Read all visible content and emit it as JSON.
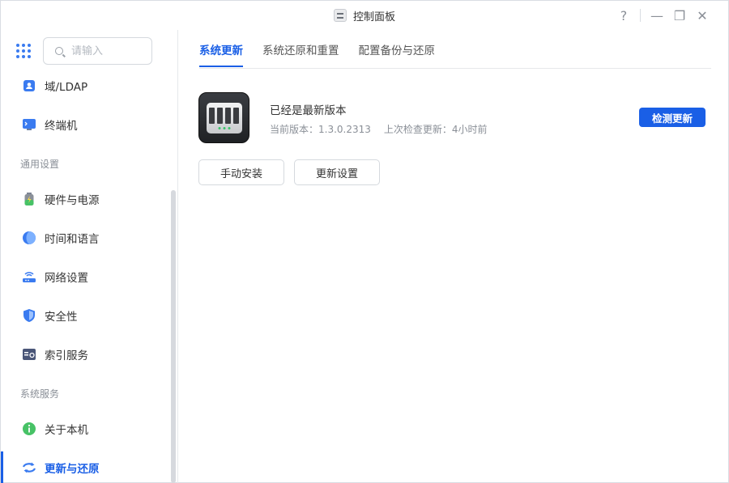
{
  "window": {
    "title": "控制面板",
    "controls": {
      "help": "?",
      "minimize": "—",
      "restore": "❐",
      "close": "✕"
    }
  },
  "sidebar": {
    "search_placeholder": "请输入",
    "items": [
      {
        "label": "域/LDAP",
        "icon": "ldap-icon"
      },
      {
        "label": "终端机",
        "icon": "terminal-icon"
      },
      {
        "section": "通用设置"
      },
      {
        "label": "硬件与电源",
        "icon": "battery-icon"
      },
      {
        "label": "时间和语言",
        "icon": "globe-icon"
      },
      {
        "label": "网络设置",
        "icon": "router-icon"
      },
      {
        "label": "安全性",
        "icon": "shield-icon"
      },
      {
        "label": "索引服务",
        "icon": "index-icon"
      },
      {
        "section": "系统服务"
      },
      {
        "label": "关于本机",
        "icon": "info-icon"
      },
      {
        "label": "更新与还原",
        "icon": "refresh-icon",
        "active": true
      }
    ]
  },
  "main": {
    "tabs": [
      {
        "label": "系统更新",
        "active": true
      },
      {
        "label": "系统还原和重置"
      },
      {
        "label": "配置备份与还原"
      }
    ],
    "status_title": "已经是最新版本",
    "current_version": "当前版本：1.3.0.2313",
    "last_check": "上次检查更新：4小时前",
    "check_button": "检测更新",
    "manual_install_button": "手动安装",
    "update_settings_button": "更新设置"
  },
  "colors": {
    "accent": "#1a5fe6",
    "text": "#333333",
    "muted": "#8a8f97"
  }
}
